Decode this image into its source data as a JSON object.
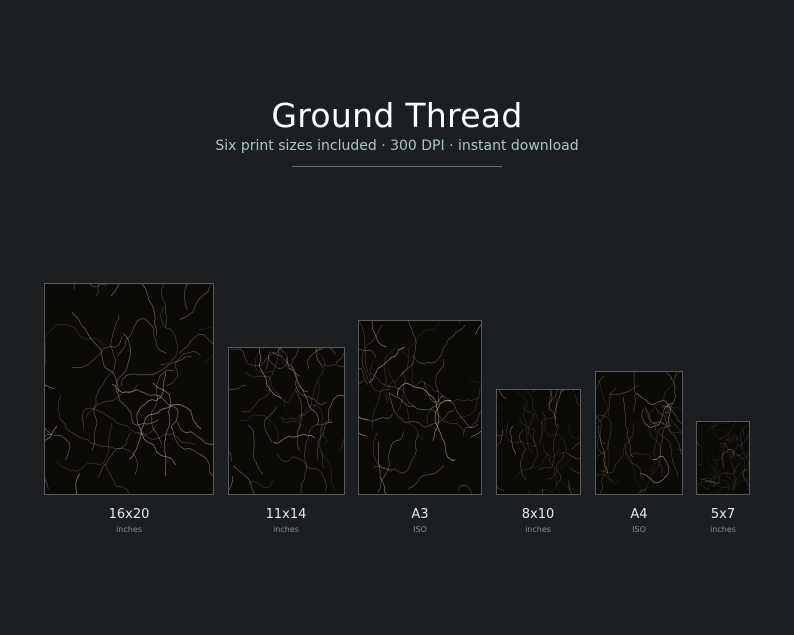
{
  "header": {
    "title": "Ground Thread",
    "subtitle": "Six print sizes included  ·  300 DPI  ·  instant download"
  },
  "colors": {
    "background": "#1b1e22",
    "accent_line": "#4a7d6e",
    "subtitle": "#a9c9bf",
    "artwork_base": "#0b0a07",
    "artwork_thread": "#d8c9a0"
  },
  "prints": [
    {
      "size": "16x20",
      "unit": "inches"
    },
    {
      "size": "11x14",
      "unit": "inches"
    },
    {
      "size": "A3",
      "unit": "ISO"
    },
    {
      "size": "8x10",
      "unit": "inches"
    },
    {
      "size": "A4",
      "unit": "ISO"
    },
    {
      "size": "5x7",
      "unit": "inches"
    }
  ]
}
